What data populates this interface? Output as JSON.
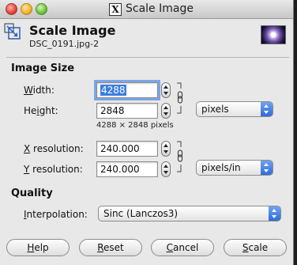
{
  "window": {
    "title": "Scale Image",
    "x11_glyph": "X"
  },
  "header": {
    "title": "Scale Image",
    "subtitle": "DSC_0191.jpg-2"
  },
  "image_size": {
    "section_label": "Image Size",
    "width_label_key": "W",
    "width_label_rest": "idth:",
    "height_label_pre": "He",
    "height_label_key": "i",
    "height_label_rest": "ght:",
    "width_value": "4288",
    "height_value": "2848",
    "size_unit": "pixels",
    "size_info": "4288 × 2848 pixels",
    "xres_label_key": "X",
    "xres_label_rest": " resolution:",
    "yres_label_key": "Y",
    "yres_label_rest": " resolution:",
    "xres_value": "240.000",
    "yres_value": "240.000",
    "res_unit": "pixels/in"
  },
  "quality": {
    "section_label": "Quality",
    "interp_label_key": "I",
    "interp_label_rest": "nterpolation:",
    "interpolation": "Sinc (Lanczos3)"
  },
  "buttons": {
    "help_key": "H",
    "help_rest": "elp",
    "reset_key": "R",
    "reset_rest": "eset",
    "cancel_key": "C",
    "cancel_rest": "ancel",
    "scale_key": "S",
    "scale_rest": "cale"
  },
  "colors": {
    "selection": "#3b7de0",
    "select_accent": "#2e6cd8"
  },
  "icons": [
    "close-icon",
    "minimize-icon",
    "zoom-icon",
    "x11-icon",
    "scale-image-icon",
    "chain-icon",
    "spinner-icon"
  ]
}
